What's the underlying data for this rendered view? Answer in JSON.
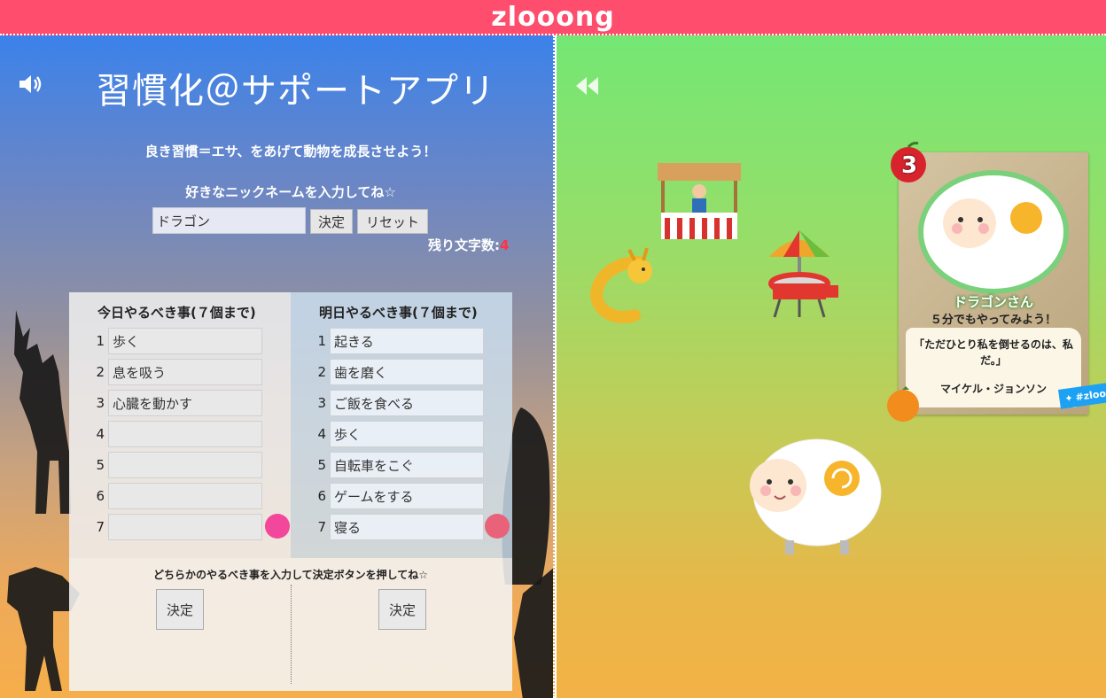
{
  "header": {
    "logo": "zlooong",
    "brand_color": "#ff4d6d"
  },
  "left": {
    "speaker_icon": "speaker-icon",
    "title": "習慣化＠サポートアプリ",
    "tagline": "良き習慣＝エサ、をあげて動物を成長させよう！",
    "nickname_label": "好きなニックネームを入力してね☆",
    "nickname_value": "ドラゴン",
    "decide_label": "決定",
    "reset_label": "リセット",
    "remaining_label": "残り文字数:",
    "remaining_value": "4"
  },
  "tasks": {
    "today": {
      "title": "今日やるべき事(７個まで)",
      "items": [
        {
          "num": "1",
          "text": "歩く"
        },
        {
          "num": "2",
          "text": "息を吸う"
        },
        {
          "num": "3",
          "text": "心臓を動かす"
        },
        {
          "num": "4",
          "text": ""
        },
        {
          "num": "5",
          "text": ""
        },
        {
          "num": "6",
          "text": ""
        },
        {
          "num": "7",
          "text": ""
        }
      ],
      "dot_color": "#f2479a"
    },
    "tomorrow": {
      "title": "明日やるべき事(７個まで)",
      "items": [
        {
          "num": "1",
          "text": "起きる"
        },
        {
          "num": "2",
          "text": "歯を磨く"
        },
        {
          "num": "3",
          "text": "ご飯を食べる"
        },
        {
          "num": "4",
          "text": "歩く"
        },
        {
          "num": "5",
          "text": "自転車をこぐ"
        },
        {
          "num": "6",
          "text": "ゲームをする"
        },
        {
          "num": "7",
          "text": "寝る"
        }
      ],
      "dot_color": "#e8637a"
    },
    "instruction": "どちらかのやるべき事を入力して決定ボタンを押してね☆",
    "decide_today": "決定",
    "decide_tomorrow": "決定"
  },
  "right": {
    "rewind_icon": "rewind-icon",
    "level": "3",
    "profile_name": "ドラゴンさん",
    "profile_sub": "５分でもやってみよう！",
    "quote": "「ただひとり私を倒せるのは、私だ。」",
    "author": "マイケル・ジョンソン",
    "twitter_label": "#zlooo"
  }
}
